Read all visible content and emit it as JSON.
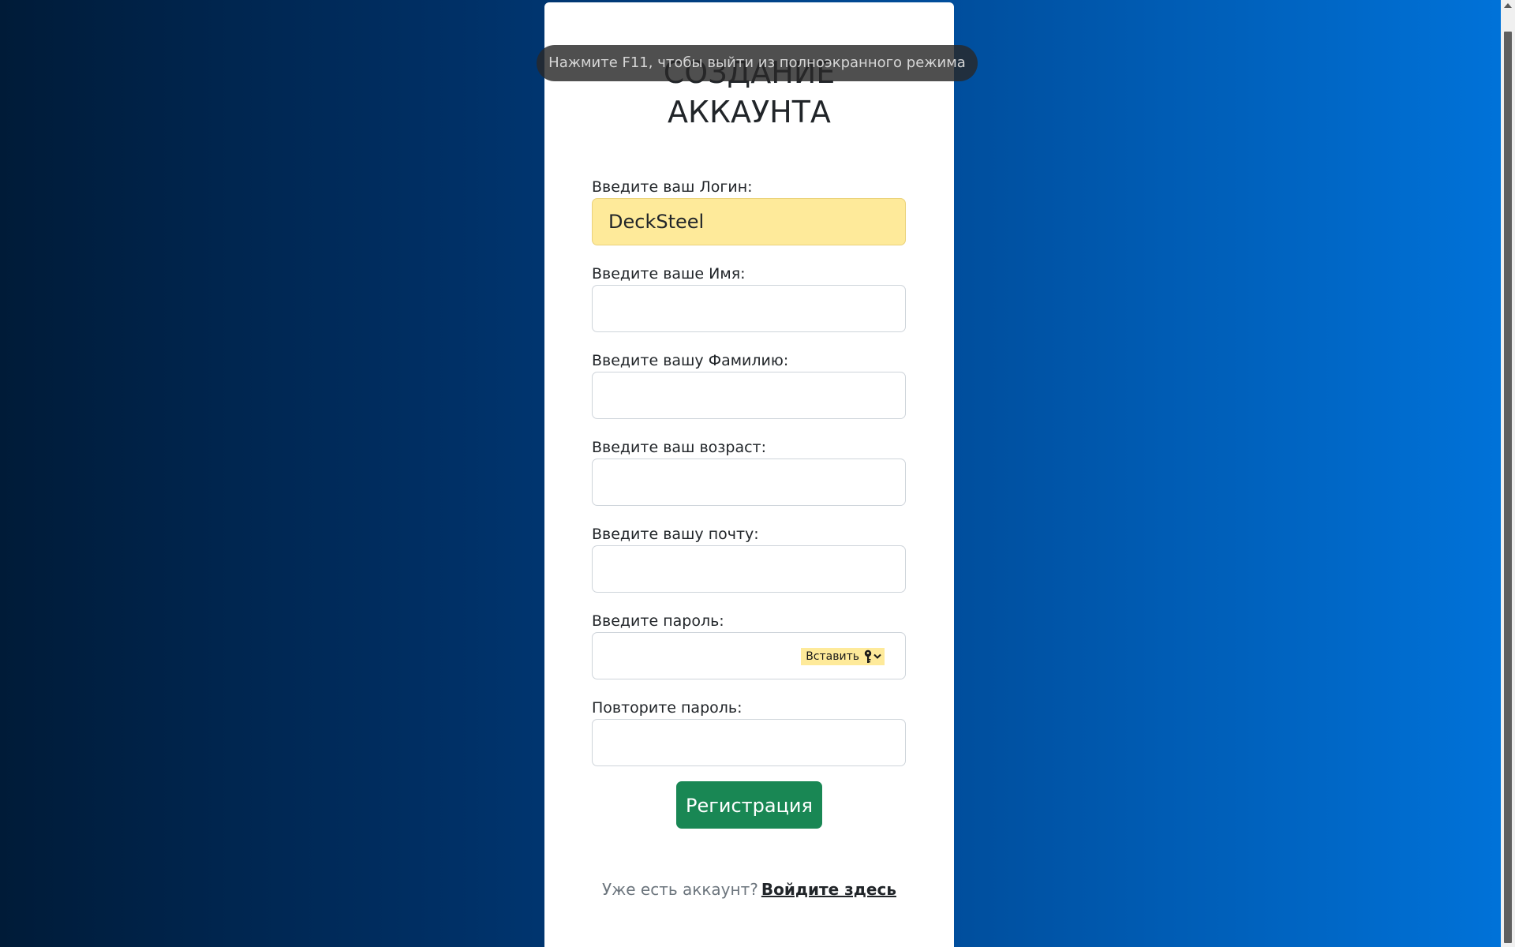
{
  "form": {
    "title_line1": "СОЗДАНИЕ",
    "title_line2": "АККАУНТА",
    "fields": [
      {
        "label": "Введите ваш Логин:",
        "value": "DeckSteel",
        "autofilled": true
      },
      {
        "label": "Введите ваше Имя:",
        "value": ""
      },
      {
        "label": "Введите вашу Фамилию:",
        "value": ""
      },
      {
        "label": "Введите ваш возраст:",
        "value": ""
      },
      {
        "label": "Введите вашу почту:",
        "value": ""
      },
      {
        "label": "Введите пароль:",
        "value": "",
        "paste_label": "Вставить"
      },
      {
        "label": "Повторите пароль:",
        "value": ""
      }
    ],
    "submit_label": "Регистрация",
    "have_account_text": "Уже есть аккаунт?",
    "login_link": "Войдите здесь"
  },
  "fullscreen_notice": "Нажмите F11, чтобы выйти из полноэкранного режима",
  "colors": {
    "submit": "#198754",
    "autofill": "#feea9a",
    "background_start": "#001b38",
    "background_end": "#0073da"
  },
  "icons": [
    "key-icon",
    "chevron-down-icon"
  ]
}
